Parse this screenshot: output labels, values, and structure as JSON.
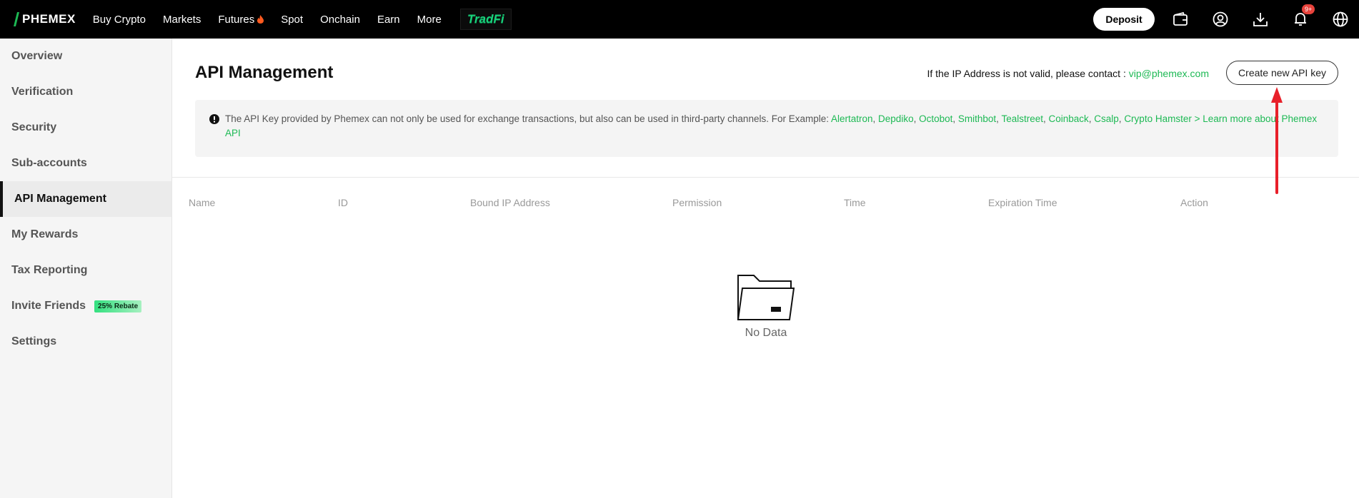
{
  "topnav": {
    "logo": "PHEMEX",
    "items": [
      "Buy Crypto",
      "Markets",
      "Futures",
      "Spot",
      "Onchain",
      "Earn",
      "More"
    ],
    "tradfi_label": "TradFi",
    "deposit": "Deposit",
    "notification_badge": "9+",
    "icons": [
      "wallet-icon",
      "user-icon",
      "download-icon",
      "bell-icon",
      "globe-icon"
    ],
    "futures_icon": "flame-icon"
  },
  "sidebar": {
    "items": [
      {
        "label": "Overview"
      },
      {
        "label": "Verification"
      },
      {
        "label": "Security"
      },
      {
        "label": "Sub-accounts"
      },
      {
        "label": "API Management",
        "active": true
      },
      {
        "label": "My Rewards"
      },
      {
        "label": "Tax Reporting"
      },
      {
        "label": "Invite Friends"
      },
      {
        "label": "Settings"
      }
    ],
    "rebate_badge": "25% Rebate"
  },
  "main": {
    "title": "API Management",
    "contact_text": "If the IP Address is not valid, please contact : ",
    "contact_email": "vip@phemex.com",
    "create_button": "Create new API key",
    "notice": {
      "text": "The API Key provided by Phemex can not only be used for exchange transactions, but also can be used in third-party channels. For Example: ",
      "partners": [
        "Alertatron",
        "Depdiko",
        "Octobot",
        "Smithbot",
        "Tealstreet",
        "Coinback",
        "Csalp",
        "Crypto Hamster"
      ],
      "separator": ", ",
      "learn_more": " > Learn more about Phemex API"
    },
    "table": {
      "columns": [
        "Name",
        "ID",
        "Bound IP Address",
        "Permission",
        "Time",
        "Expiration Time",
        "Action"
      ]
    },
    "empty_text": "No Data"
  },
  "colors": {
    "accent_green": "#1db954",
    "nav_bg": "#000000",
    "arrow_red": "#e8202a",
    "badge_red": "#e8433c"
  }
}
